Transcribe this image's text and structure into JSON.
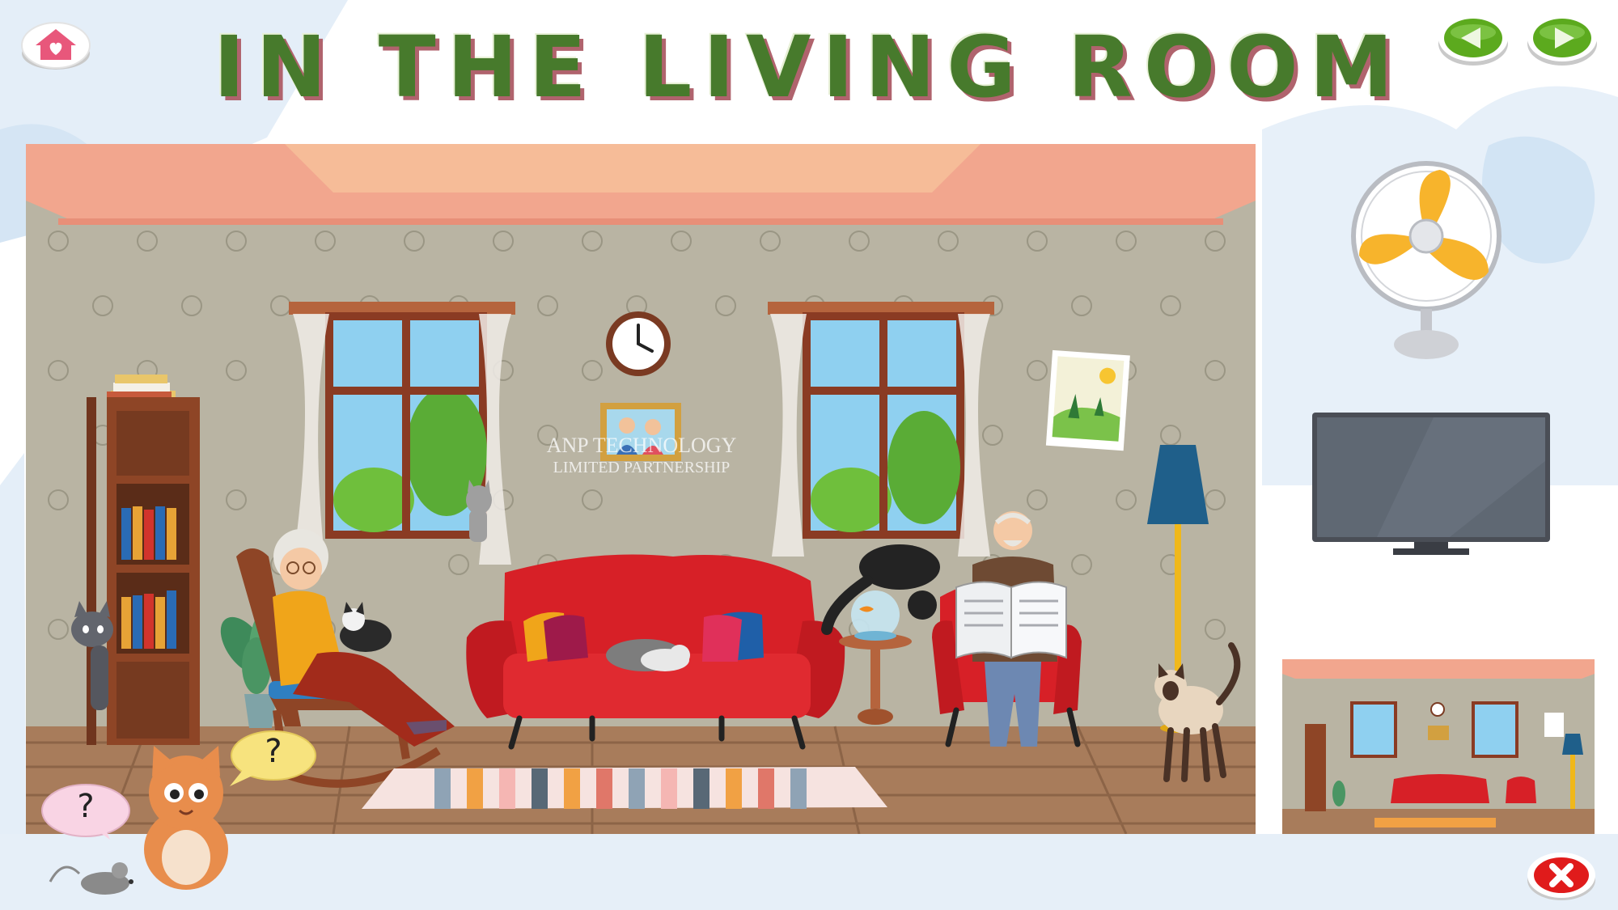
{
  "page": {
    "title": "IN THE LIVING ROOM",
    "watermark_line1": "ANP TECHNOLOGY",
    "watermark_line2": "LIMITED PARTNERSHIP"
  },
  "hints": {
    "mouse_bubble": "?",
    "cat_bubble": "?"
  },
  "icons": {
    "home": "home-heart-icon",
    "prev": "triangle-left-icon",
    "next": "triangle-right-icon",
    "close": "x-close-icon"
  },
  "colors": {
    "title": "#477a2c",
    "title_shadow": "#b0636d",
    "nav_green": "#5caa1e",
    "close_red": "#e01b1b",
    "home_pink": "#e8577b",
    "ceiling": "#f2a68e",
    "wall": "#b9b4a3",
    "floor": "#a87c5b",
    "sofa": "#d72027"
  },
  "objects": {
    "choices": [
      "fan",
      "tv"
    ],
    "scene_items": [
      "bookshelf",
      "books",
      "window-left",
      "window-right",
      "clock",
      "family-photo",
      "landscape-picture",
      "floor-lamp",
      "rocking-chair",
      "grandma",
      "sofa",
      "sleeping-cat",
      "fish-bowl",
      "black-cat",
      "side-table",
      "armchair",
      "grandpa",
      "newspaper",
      "siamese-cat",
      "grey-cat",
      "tabby-cat",
      "potted-plant",
      "striped-rug"
    ]
  }
}
